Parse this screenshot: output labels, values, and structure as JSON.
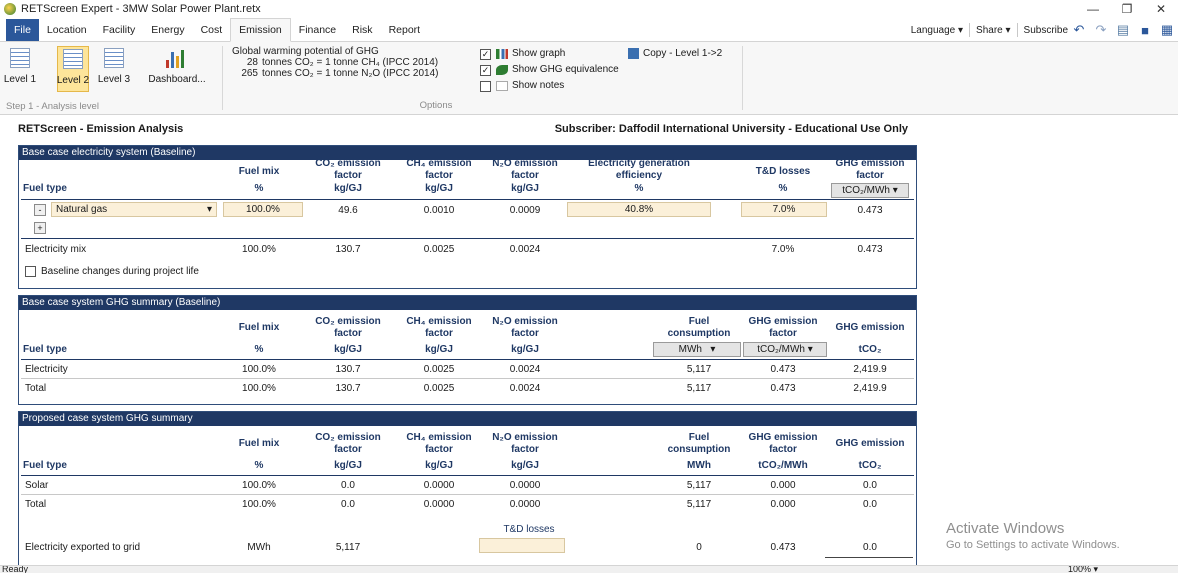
{
  "window": {
    "title": "RETScreen Expert - 3MW Solar Power Plant.retx",
    "controls": [
      "—",
      "❐",
      "✕"
    ]
  },
  "ribbon_tabs": [
    "File",
    "Location",
    "Facility",
    "Energy",
    "Cost",
    "Emission",
    "Finance",
    "Risk",
    "Report"
  ],
  "ribbon_right": {
    "language": "Language ▾",
    "share": "Share ▾",
    "subscribe": "Subscribe"
  },
  "ribbon": {
    "levels": [
      "Level 1",
      "Level 2",
      "Level 3"
    ],
    "dashboard": "Dashboard...",
    "step_label": "Step 1 - Analysis level",
    "gwp_title": "Global warming potential of GHG",
    "gwp_rows": [
      {
        "n": "28",
        "t": "tonnes CO₂ = 1 tonne CH₄  (IPCC 2014)"
      },
      {
        "n": "265",
        "t": "tonnes CO₂ = 1 tonne N₂O  (IPCC 2014)"
      }
    ],
    "options_label": "Options",
    "show_graph": "Show graph",
    "show_ghg": "Show GHG equivalence",
    "show_notes": "Show notes",
    "copy_level": "Copy - Level 1->2"
  },
  "header": {
    "left": "RETScreen - Emission Analysis",
    "right": "Subscriber: Daffodil International University - Educational Use Only"
  },
  "baseline": {
    "title": "Base case electricity system (Baseline)",
    "col_fuel_type": "Fuel type",
    "col_fuel_mix": "Fuel mix",
    "col_fuel_mix_u": "%",
    "col_co2": "CO₂ emission factor",
    "col_co2_u": "kg/GJ",
    "col_ch4": "CH₄ emission factor",
    "col_ch4_u": "kg/GJ",
    "col_n2o": "N₂O emission factor",
    "col_n2o_u": "kg/GJ",
    "col_eff": "Electricity generation efficiency",
    "col_eff_u": "%",
    "col_td": "T&D losses",
    "col_td_u": "%",
    "col_ghg": "GHG emission factor",
    "col_ghg_u": "tCO₂/MWh",
    "row1": {
      "fuel": "Natural gas",
      "mix": "100.0%",
      "co2": "49.6",
      "ch4": "0.0010",
      "n2o": "0.0009",
      "eff": "40.8%",
      "td": "7.0%",
      "ghg": "0.473"
    },
    "row2": {
      "fuel": "Electricity mix",
      "mix": "100.0%",
      "co2": "130.7",
      "ch4": "0.0025",
      "n2o": "0.0024",
      "td": "7.0%",
      "ghg": "0.473"
    },
    "changes_label": "Baseline changes during project life"
  },
  "summary": {
    "title": "Base case system GHG summary (Baseline)",
    "col_fuel_type": "Fuel type",
    "col_fuel_mix": "Fuel mix",
    "col_fuel_mix_u": "%",
    "col_co2": "CO₂ emission factor",
    "col_co2_u": "kg/GJ",
    "col_ch4": "CH₄ emission factor",
    "col_ch4_u": "kg/GJ",
    "col_n2o": "N₂O emission factor",
    "col_n2o_u": "kg/GJ",
    "col_fc": "Fuel consumption",
    "col_fc_u": "MWh",
    "col_ghgf": "GHG emission factor",
    "col_ghgf_u": "tCO₂/MWh",
    "col_ghg": "GHG emission",
    "col_ghg_u": "tCO₂",
    "rows": [
      {
        "fuel": "Electricity",
        "mix": "100.0%",
        "co2": "130.7",
        "ch4": "0.0025",
        "n2o": "0.0024",
        "fc": "5,117",
        "ghgf": "0.473",
        "ghg": "2,419.9"
      },
      {
        "fuel": "Total",
        "mix": "100.0%",
        "co2": "130.7",
        "ch4": "0.0025",
        "n2o": "0.0024",
        "fc": "5,117",
        "ghgf": "0.473",
        "ghg": "2,419.9"
      }
    ]
  },
  "proposed": {
    "title": "Proposed case system GHG summary",
    "col_fuel_type": "Fuel type",
    "col_fuel_mix": "Fuel mix",
    "col_fuel_mix_u": "%",
    "col_co2": "CO₂ emission factor",
    "col_co2_u": "kg/GJ",
    "col_ch4": "CH₄ emission factor",
    "col_ch4_u": "kg/GJ",
    "col_n2o": "N₂O emission factor",
    "col_n2o_u": "kg/GJ",
    "col_fc": "Fuel consumption",
    "col_fc_u": "MWh",
    "col_ghgf": "GHG emission factor",
    "col_ghgf_u": "tCO₂/MWh",
    "col_ghg": "GHG emission",
    "col_ghg_u": "tCO₂",
    "rows": [
      {
        "fuel": "Solar",
        "mix": "100.0%",
        "co2": "0.0",
        "ch4": "0.0000",
        "n2o": "0.0000",
        "fc": "5,117",
        "ghgf": "0.000",
        "ghg": "0.0"
      },
      {
        "fuel": "Total",
        "mix": "100.0%",
        "co2": "0.0",
        "ch4": "0.0000",
        "n2o": "0.0000",
        "fc": "5,117",
        "ghgf": "0.000",
        "ghg": "0.0"
      }
    ],
    "td_label": "T&D losses",
    "export": {
      "label": "Electricity exported to grid",
      "unit": "MWh",
      "value": "5,117",
      "fc": "0",
      "ghgf": "0.473",
      "ghg": "0.0"
    }
  },
  "status": {
    "left": "Ready",
    "zoom": "100% ▾"
  },
  "watermark": {
    "line1": "Activate Windows",
    "line2": "Go to Settings to activate Windows."
  }
}
